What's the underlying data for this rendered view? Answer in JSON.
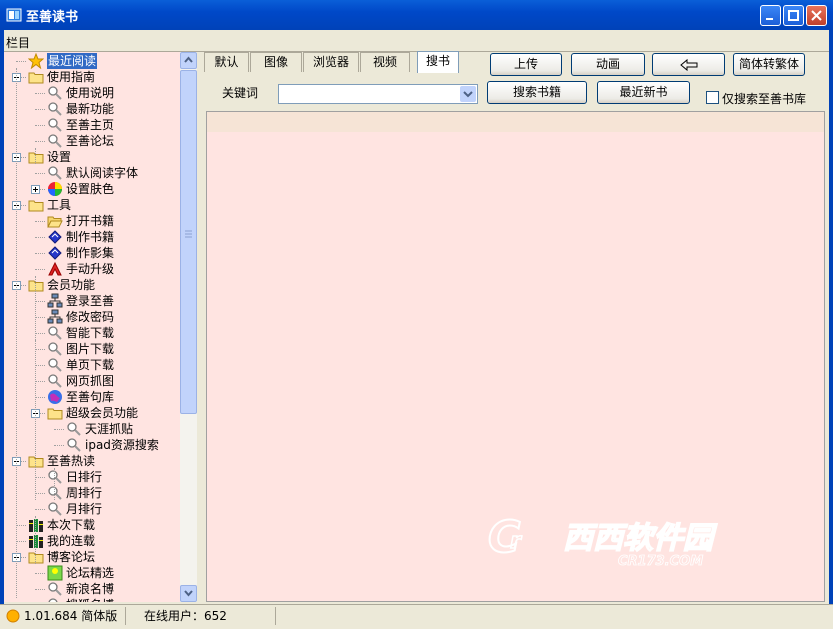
{
  "window": {
    "title": "至善读书"
  },
  "sidebar": {
    "header": "栏目",
    "items": [
      {
        "label": "最近阅读",
        "icon": "star-icon",
        "selected": true
      },
      {
        "label": "使用指南",
        "icon": "folder-icon"
      },
      {
        "label": "使用说明",
        "icon": "magnifier-icon"
      },
      {
        "label": "最新功能",
        "icon": "magnifier-icon"
      },
      {
        "label": "至善主页",
        "icon": "magnifier-icon"
      },
      {
        "label": "至善论坛",
        "icon": "magnifier-icon"
      },
      {
        "label": "设置",
        "icon": "folder-icon"
      },
      {
        "label": "默认阅读字体",
        "icon": "magnifier-icon"
      },
      {
        "label": "设置肤色",
        "icon": "color-wheel-icon"
      },
      {
        "label": "工具",
        "icon": "folder-icon"
      },
      {
        "label": "打开书籍",
        "icon": "open-folder-icon"
      },
      {
        "label": "制作书籍",
        "icon": "book-icon"
      },
      {
        "label": "制作影集",
        "icon": "book-icon"
      },
      {
        "label": "手动升级",
        "icon": "upgrade-icon"
      },
      {
        "label": "会员功能",
        "icon": "folder-icon"
      },
      {
        "label": "登录至善",
        "icon": "network-icon"
      },
      {
        "label": "修改密码",
        "icon": "network-icon"
      },
      {
        "label": "智能下载",
        "icon": "magnifier-icon"
      },
      {
        "label": "图片下载",
        "icon": "magnifier-icon"
      },
      {
        "label": "单页下载",
        "icon": "magnifier-icon"
      },
      {
        "label": "网页抓图",
        "icon": "magnifier-icon"
      },
      {
        "label": "至善句库",
        "icon": "globe-icon"
      },
      {
        "label": "超级会员功能",
        "icon": "folder-icon"
      },
      {
        "label": "天涯抓贴",
        "icon": "magnifier-icon"
      },
      {
        "label": "ipad资源搜索",
        "icon": "magnifier-icon"
      },
      {
        "label": "至善热读",
        "icon": "folder-icon"
      },
      {
        "label": "日排行",
        "icon": "magnifier-icon"
      },
      {
        "label": "周排行",
        "icon": "magnifier-icon"
      },
      {
        "label": "月排行",
        "icon": "magnifier-icon"
      },
      {
        "label": "本次下载",
        "icon": "books-icon"
      },
      {
        "label": "我的连载",
        "icon": "books-icon"
      },
      {
        "label": "博客论坛",
        "icon": "folder-icon"
      },
      {
        "label": "论坛精选",
        "icon": "forum-icon"
      },
      {
        "label": "新浪名博",
        "icon": "magnifier-icon"
      },
      {
        "label": "搜狐名博",
        "icon": "magnifier-icon"
      }
    ]
  },
  "tabs": [
    "默认",
    "图像",
    "浏览器",
    "视频",
    "搜书"
  ],
  "toolbar": {
    "upload": "上传",
    "animation": "动画",
    "convert": "简体转繁体",
    "keyword_label": "关键词",
    "keyword_value": "",
    "search_books": "搜索书籍",
    "latest_books": "最近新书",
    "only_zhishan": "仅搜索至善书库"
  },
  "status": {
    "version": "1.01.684 简体版",
    "online_users": "在线用户：652"
  },
  "colors": {
    "title_bar": "#0048c8",
    "panel_bg": "#ffe4e1",
    "selected": "#316ac5"
  }
}
